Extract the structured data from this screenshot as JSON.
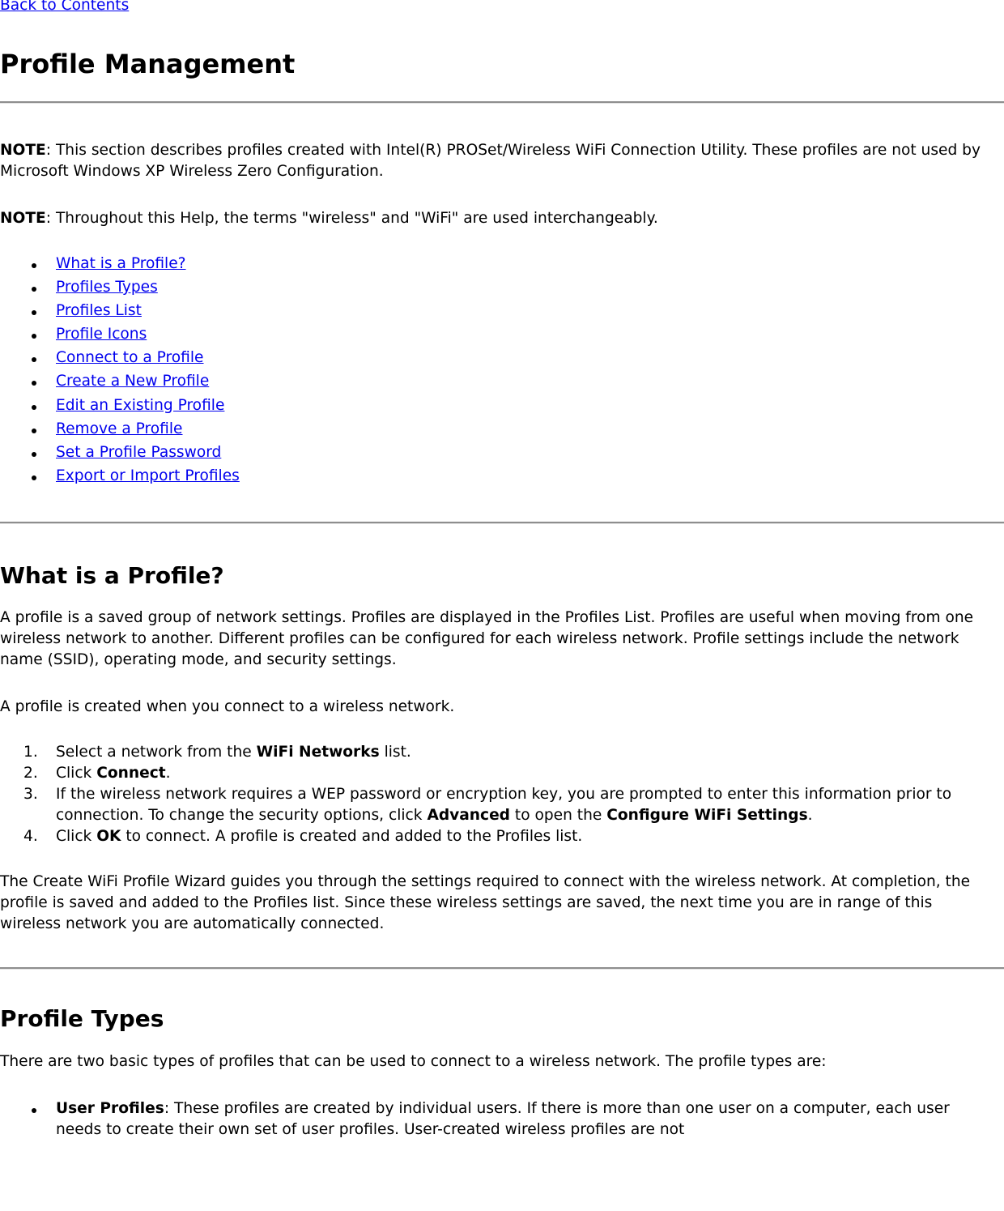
{
  "nav": {
    "back_link": "Back to Contents"
  },
  "page": {
    "title": "Profile Management",
    "note1_label": "NOTE",
    "note1_text": ": This section describes profiles created with Intel(R) PROSet/Wireless WiFi Connection Utility. These profiles are not used by Microsoft Windows XP Wireless Zero Configuration.",
    "note2_label": "NOTE",
    "note2_text": ": Throughout this Help, the terms \"wireless\" and \"WiFi\" are used interchangeably.",
    "toc": [
      "What is a Profile?",
      "Profiles Types",
      "Profiles List",
      "Profile Icons",
      "Connect to a Profile",
      "Create a New Profile",
      "Edit an Existing Profile",
      "Remove a Profile",
      "Set a Profile Password",
      "Export or Import Profiles"
    ]
  },
  "what_is_profile": {
    "heading": "What is a Profile?",
    "para1": "A profile is a saved group of network settings. Profiles are displayed in the Profiles List. Profiles are useful when moving from one wireless network to another. Different profiles can be configured for each wireless network. Profile settings include the network name (SSID), operating mode, and security settings.",
    "para2": "A profile is created when you connect to a wireless network.",
    "steps": [
      {
        "num": "1.",
        "pre": "Select a network from the ",
        "bold": "WiFi Networks",
        "post": " list."
      },
      {
        "num": "2.",
        "pre": "Click ",
        "bold": "Connect",
        "post": "."
      },
      {
        "num": "3.",
        "pre": "If the wireless network requires a WEP password or encryption key, you are prompted to enter this information prior to connection. To change the security options, click ",
        "bold": "Advanced",
        "mid": " to open the ",
        "bold2": "Configure WiFi Settings",
        "post": "."
      },
      {
        "num": "4.",
        "pre": "Click ",
        "bold": "OK",
        "post": " to connect. A profile is created and added to the Profiles list."
      }
    ],
    "para3": "The Create WiFi Profile Wizard guides you through the settings required to connect with the wireless network. At completion, the profile is saved and added to the Profiles list. Since these wireless settings are saved, the next time you are in range of this wireless network you are automatically connected."
  },
  "profile_types": {
    "heading": "Profile Types",
    "intro": "There are two basic types of profiles that can be used to connect to a wireless network. The profile types are:",
    "items": [
      {
        "bold": "User Profiles",
        "text": ": These profiles are created by individual users. If there is more than one user on a computer, each user needs to create their own set of user profiles. User-created wireless profiles are not"
      }
    ]
  }
}
